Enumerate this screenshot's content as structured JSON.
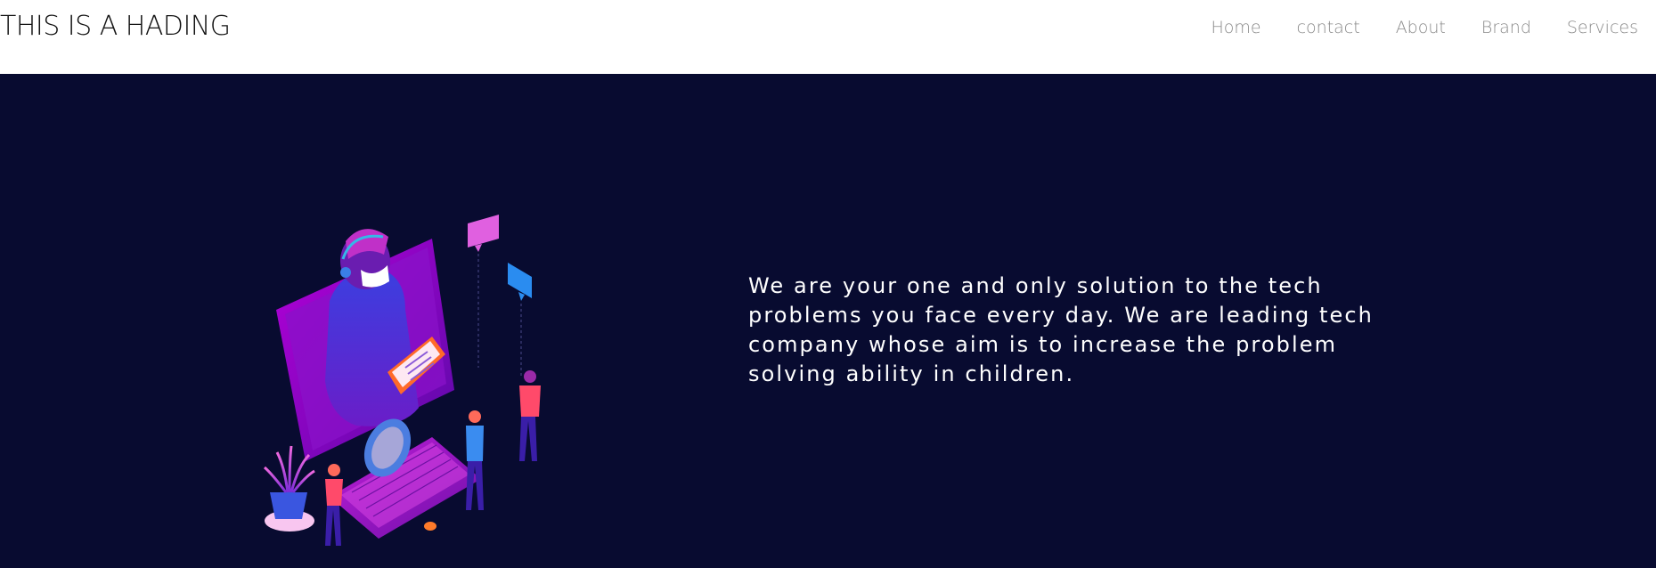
{
  "header": {
    "brand": "THIS IS A HADING",
    "nav": [
      {
        "label": "Home"
      },
      {
        "label": "contact"
      },
      {
        "label": "About"
      },
      {
        "label": "Brand"
      },
      {
        "label": "Services"
      }
    ]
  },
  "hero": {
    "illustration": "tech-support-isometric-illustration",
    "lines": [
      "We are your one and only solution to the tech",
      "problems you face every day. We are leading tech",
      "company whose aim is to increase the problem",
      "solving ability in children."
    ]
  },
  "colors": {
    "hero_background": "#080b30",
    "nav_text": "#8a8a8a",
    "brand_text": "#111111",
    "hero_text": "#ffffff"
  }
}
